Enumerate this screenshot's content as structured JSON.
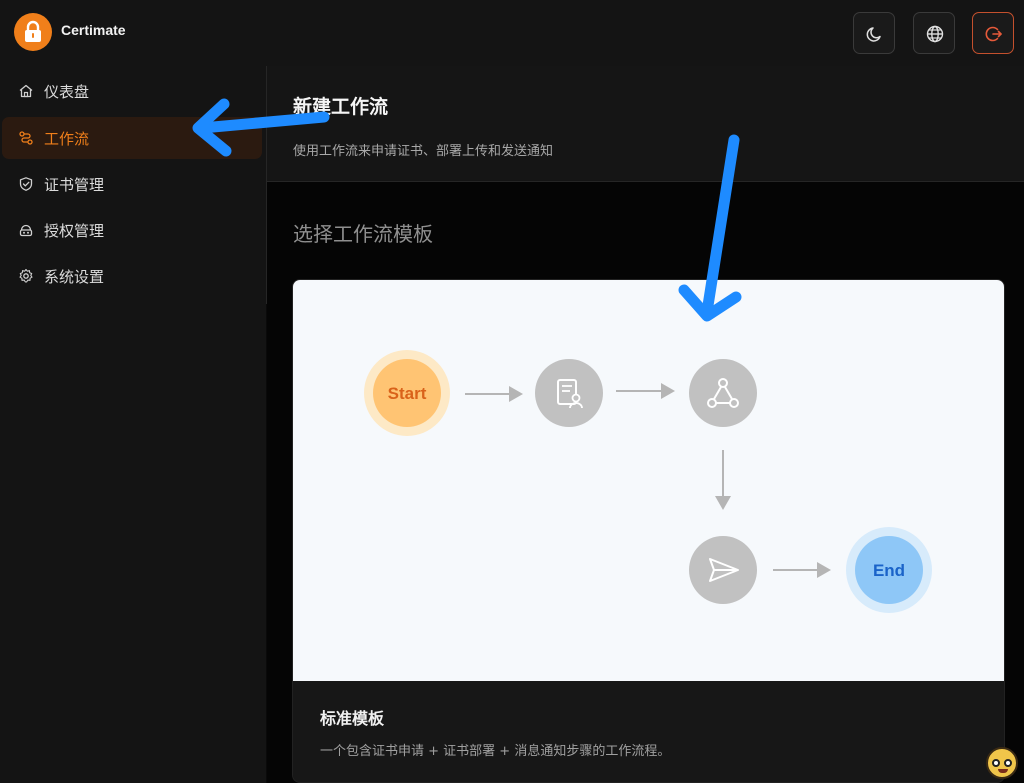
{
  "app": {
    "name": "Certimate",
    "logo_icon": "lock-icon",
    "brand_color": "#f07f1a"
  },
  "topbar": {
    "theme_icon": "moon-icon",
    "language_icon": "globe-icon",
    "logout_icon": "logout-icon"
  },
  "sidebar": {
    "items": [
      {
        "label": "仪表盘",
        "icon": "home-icon",
        "active": false
      },
      {
        "label": "工作流",
        "icon": "workflow-icon",
        "active": true
      },
      {
        "label": "证书管理",
        "icon": "shield-check-icon",
        "active": false
      },
      {
        "label": "授权管理",
        "icon": "access-icon",
        "active": false
      },
      {
        "label": "系统设置",
        "icon": "gear-icon",
        "active": false
      }
    ]
  },
  "main": {
    "title": "新建工作流",
    "subtitle": "使用工作流来申请证书、部署上传和发送通知",
    "section_title": "选择工作流模板",
    "template": {
      "title": "标准模板",
      "description": "一个包含证书申请 + 证书部署 + 消息通知步骤的工作流程。",
      "diagram": {
        "start_label": "Start",
        "end_label": "End",
        "step_icons": [
          "certificate-apply-icon",
          "deploy-nodes-icon",
          "send-icon"
        ]
      }
    }
  },
  "annotations": {
    "arrow_color": "#1e8bff"
  }
}
